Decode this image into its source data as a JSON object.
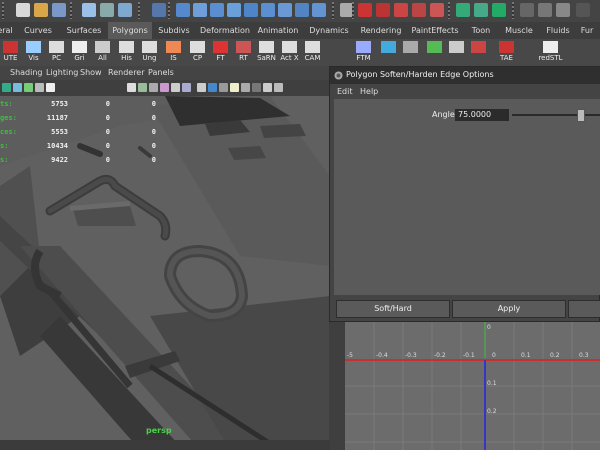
{
  "shelf_tabs": [
    {
      "label": "eral",
      "active": false
    },
    {
      "label": "Curves",
      "active": false
    },
    {
      "label": "Surfaces",
      "active": false
    },
    {
      "label": "Polygons",
      "active": true
    },
    {
      "label": "Subdivs",
      "active": false
    },
    {
      "label": "Deformation",
      "active": false
    },
    {
      "label": "Animation",
      "active": false
    },
    {
      "label": "Dynamics",
      "active": false
    },
    {
      "label": "Rendering",
      "active": false
    },
    {
      "label": "PaintEffects",
      "active": false
    },
    {
      "label": "Toon",
      "active": false
    },
    {
      "label": "Muscle",
      "active": false
    },
    {
      "label": "Fluids",
      "active": false
    },
    {
      "label": "Fur",
      "active": false
    }
  ],
  "shelf_buttons": [
    "UTE",
    "Vis",
    "PC",
    "Gri",
    "All",
    "His",
    "Ung",
    "IS",
    "CP",
    "FT",
    "RT",
    "SaRN",
    "Act X",
    "CAM",
    "FTM",
    "",
    "",
    "",
    "",
    "",
    "TAE",
    "redSTL"
  ],
  "viewport": {
    "menu": [
      "Shading",
      "Lighting",
      "Show",
      "Renderer",
      "Panels"
    ],
    "hud_labels": [
      "ts:",
      "ges:",
      "ces:",
      "s:",
      "s:"
    ],
    "hud_rows": [
      {
        "count": "5753",
        "a": "0",
        "b": "0"
      },
      {
        "count": "11187",
        "a": "0",
        "b": "0"
      },
      {
        "count": "5553",
        "a": "0",
        "b": "0"
      },
      {
        "count": "10434",
        "a": "0",
        "b": "0"
      },
      {
        "count": "9422",
        "a": "0",
        "b": "0"
      }
    ],
    "camera": "persp"
  },
  "dialog": {
    "title": "Polygon Soften/Harden Edge Options",
    "menu": [
      "Edit",
      "Help"
    ],
    "angle_label": "Angle",
    "angle_value": "75.0000",
    "angle_fraction": 0.83,
    "buttons": [
      "Soft/Hard",
      "Apply"
    ]
  },
  "uv": {
    "u_labels": [
      "-5",
      "-0.4",
      "-0.3",
      "-0.2",
      "-0.1",
      "0",
      "0.1",
      "0.2",
      "0.3"
    ],
    "v_labels": [
      "0.1",
      "0.2"
    ],
    "origin_label": "0"
  },
  "colors": {
    "hud_label": "#3fbf3f",
    "camera_label": "#4cd14c",
    "uv_axis_u": "#c83030",
    "uv_axis_v": "#3535c8",
    "uv_axis_green": "#40c040"
  }
}
